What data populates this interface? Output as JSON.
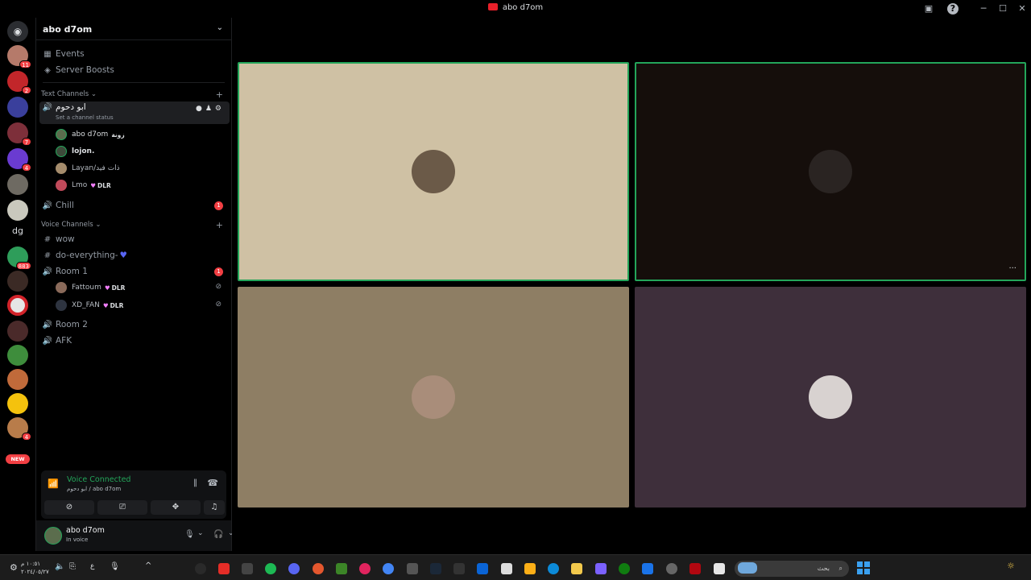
{
  "window": {
    "title": "abo d7om"
  },
  "server": {
    "name": "abo d7om"
  },
  "sidebar": {
    "events": "Events",
    "boosts": "Server Boosts",
    "text_category": "Text Channels",
    "voice_category": "Voice Channels",
    "active_channel": {
      "name": "ابو دحوم",
      "status": "Set a channel status"
    },
    "active_users": [
      {
        "name": "abo d7om",
        "tag": "زونة"
      },
      {
        "name": "lojon.",
        "tag": ""
      },
      {
        "name": "Layan/ذات فيد",
        "tag": ""
      },
      {
        "name": "Lmo",
        "tag": "DLR"
      }
    ],
    "chill": {
      "name": "Chill",
      "badge": "1"
    },
    "text_channels": [
      "wow",
      "do-everything-"
    ],
    "room1": {
      "name": "Room 1",
      "badge": "1",
      "users": [
        {
          "name": "Fattoum",
          "tag": "DLR"
        },
        {
          "name": "XD_FAN",
          "tag": "DLR"
        }
      ]
    },
    "room2": "Room 2",
    "afk": "AFK"
  },
  "guild_badges": [
    "11",
    "2",
    "7",
    "4",
    "883",
    "4",
    "NEW"
  ],
  "voice": {
    "status": "Voice Connected",
    "channel": "ابو دحوم / abo d7om"
  },
  "user": {
    "name": "abo d7om",
    "status": "In voice"
  },
  "taskbar": {
    "search_placeholder": "بحث",
    "time": "١٠:٥١ م",
    "date": "٢٠٢٤/٠٥/٢٧",
    "lang": "ع"
  },
  "colors": {
    "tile1": "#cfc1a4",
    "tile2": "#150e0b",
    "tile3": "#8e7e64",
    "tile4": "#3e2f3b",
    "speaking": "#23a55a",
    "accent": "#5865f2"
  }
}
